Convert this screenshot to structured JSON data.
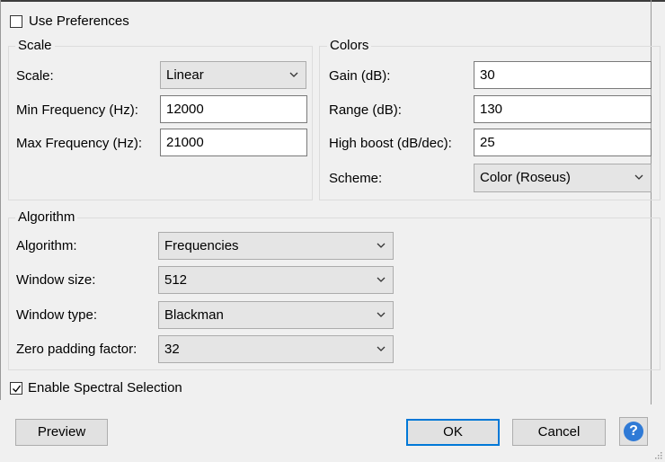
{
  "use_preferences": {
    "label": "Use Preferences",
    "checked": false
  },
  "scale_group": {
    "legend": "Scale",
    "scale_label": "Scale:",
    "scale_value": "Linear",
    "min_freq_label": "Min Frequency (Hz):",
    "min_freq_value": "12000",
    "max_freq_label": "Max Frequency (Hz):",
    "max_freq_value": "21000"
  },
  "colors_group": {
    "legend": "Colors",
    "gain_label": "Gain (dB):",
    "gain_value": "30",
    "range_label": "Range (dB):",
    "range_value": "130",
    "high_boost_label": "High boost (dB/dec):",
    "high_boost_value": "25",
    "scheme_label": "Scheme:",
    "scheme_value": "Color (Roseus)"
  },
  "algorithm_group": {
    "legend": "Algorithm",
    "algorithm_label": "Algorithm:",
    "algorithm_value": "Frequencies",
    "window_size_label": "Window size:",
    "window_size_value": "512",
    "window_type_label": "Window type:",
    "window_type_value": "Blackman",
    "zero_padding_label": "Zero padding factor:",
    "zero_padding_value": "32"
  },
  "enable_spectral": {
    "label": "Enable Spectral Selection",
    "checked": true
  },
  "buttons": {
    "preview": "Preview",
    "ok": "OK",
    "cancel": "Cancel",
    "help": "?"
  },
  "icons": {
    "dropdown": "chevron-down-icon",
    "help": "help-icon",
    "check": "checkmark-icon",
    "grip": "resize-grip-icon"
  },
  "colors": {
    "help_accent": "#2f7ad6",
    "default_button_border": "#0078d7"
  }
}
